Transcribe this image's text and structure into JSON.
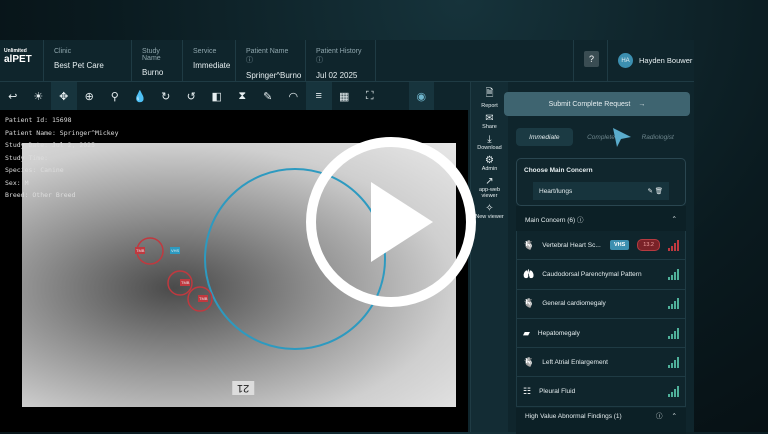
{
  "header": {
    "logo_small": "Unlimited",
    "logo_big": "alPET",
    "fields": [
      {
        "label": "Clinic",
        "value": "Best Pet Care"
      },
      {
        "label": "Study Name",
        "value": "Burno"
      },
      {
        "label": "Service",
        "value": "Immediate"
      },
      {
        "label": "Patient Name ⓘ",
        "value": "Springer^Burno"
      },
      {
        "label": "Patient History ⓘ",
        "value": "Jul 02 2025"
      }
    ],
    "help": "?",
    "user_initials": "HA",
    "user_name": "Hayden Bouwer"
  },
  "toolbar": {
    "tools": [
      "undo-icon",
      "brightness-icon",
      "pan-icon",
      "zoom-in-icon",
      "magnify-icon",
      "invert-icon",
      "rotate-right-icon",
      "rotate-left-icon",
      "flip-horizontal-icon",
      "flip-vertical-icon",
      "ruler-icon",
      "protractor-icon",
      "menu-icon",
      "layout-icon",
      "fullscreen-icon"
    ],
    "eye": "eye-icon"
  },
  "viewer": {
    "meta": [
      "Patient Id: 15698",
      "Patient Name: Springer^Mickey",
      "Study Date: Jul 2, 2025",
      "Study Time:",
      "Species: Canine",
      "Sex: M",
      "Breed: Other Breed"
    ],
    "marker": "21",
    "annotations": [
      "TMB",
      "VHS",
      "TMB",
      "TMB"
    ]
  },
  "sidebar": [
    {
      "label": "Report",
      "icon": "report-icon"
    },
    {
      "label": "Share",
      "icon": "mail-icon"
    },
    {
      "label": "Download",
      "icon": "download-icon"
    },
    {
      "label": "Admin",
      "icon": "gear-icon"
    },
    {
      "label": "app-web viewer",
      "icon": "external-link-icon"
    },
    {
      "label": "New viewer",
      "icon": "new-viewer-icon"
    }
  ],
  "panel": {
    "submit": "Submit Complete Request",
    "tabs": [
      "Immediate",
      "Complete",
      "Radiologist"
    ],
    "choose_title": "Choose Main Concern",
    "choose_value": "Heart/lungs",
    "main_concern": "Main Concern (6)",
    "items": [
      {
        "name": "Vertebral Heart Sc...",
        "badge": "VHS",
        "value": "13.2",
        "level": "high"
      },
      {
        "name": "Caudodorsal Parenchymal Pattern"
      },
      {
        "name": "General cardiomegaly"
      },
      {
        "name": "Hepatomegaly"
      },
      {
        "name": "Left Atrial Enlargement"
      },
      {
        "name": "Pleural Fluid"
      }
    ],
    "high_value": "High Value Abnormal Findings (1)"
  },
  "colors": {
    "accent": "#3c8fb0",
    "alert": "#c0393f",
    "ok": "#4fb09a"
  }
}
